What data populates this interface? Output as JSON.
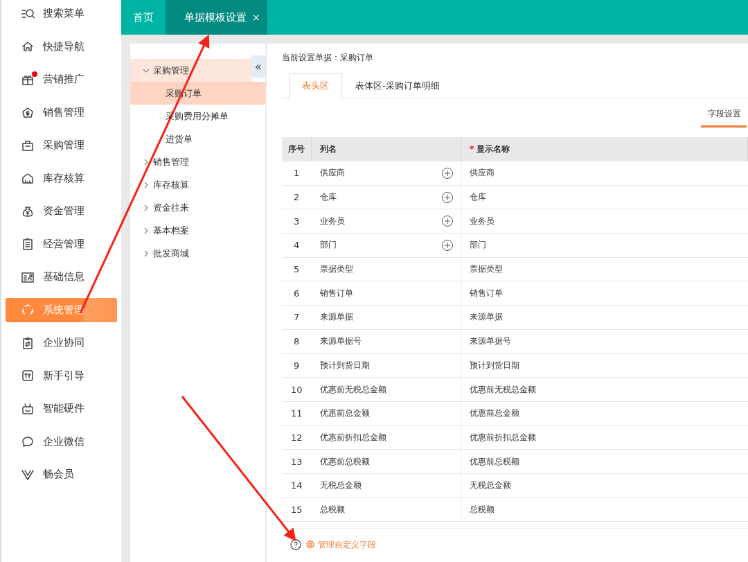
{
  "sidebar": {
    "items": [
      {
        "label": "搜索菜单",
        "selected": false,
        "notification": false
      },
      {
        "label": "快捷导航",
        "selected": false,
        "notification": false
      },
      {
        "label": "营销推广",
        "selected": false,
        "notification": true
      },
      {
        "label": "销售管理",
        "selected": false,
        "notification": false
      },
      {
        "label": "采购管理",
        "selected": false,
        "notification": false
      },
      {
        "label": "库存核算",
        "selected": false,
        "notification": false
      },
      {
        "label": "资金管理",
        "selected": false,
        "notification": false
      },
      {
        "label": "经营管理",
        "selected": false,
        "notification": false
      },
      {
        "label": "基础信息",
        "selected": false,
        "notification": false
      },
      {
        "label": "系统管理",
        "selected": true,
        "notification": false
      },
      {
        "label": "企业协同",
        "selected": false,
        "notification": false
      },
      {
        "label": "新手引导",
        "selected": false,
        "notification": false
      },
      {
        "label": "智能硬件",
        "selected": false,
        "notification": false
      },
      {
        "label": "企业微信",
        "selected": false,
        "notification": false
      },
      {
        "label": "畅会员",
        "selected": false,
        "notification": false
      }
    ]
  },
  "tabs": [
    {
      "label": "首页",
      "selected": false
    },
    {
      "label": "单据模板设置",
      "selected": true,
      "close": "×"
    }
  ],
  "tree": {
    "collapse": "«",
    "items": [
      {
        "label": "采购管理",
        "expanded": true,
        "selected": false,
        "children": [
          {
            "label": "采购订单",
            "selected": true
          },
          {
            "label": "采购费用分摊单",
            "selected": false
          },
          {
            "label": "进货单",
            "selected": false
          }
        ]
      },
      {
        "label": "销售管理",
        "expanded": false,
        "selected": false
      },
      {
        "label": "库存核算",
        "expanded": false,
        "selected": false
      },
      {
        "label": "资金往来",
        "expanded": false,
        "selected": false
      },
      {
        "label": "基本档案",
        "expanded": false,
        "selected": false
      },
      {
        "label": "批发商城",
        "expanded": false,
        "selected": false
      }
    ]
  },
  "current_document": "当前设置单据：采购订单",
  "document_tabs": [
    {
      "label": "表头区",
      "selected": true
    },
    {
      "label": "表体区-采购订单明细",
      "selected": false
    }
  ],
  "settings_tab": {
    "label": "字段设置",
    "selected": true
  },
  "table": {
    "columns": [
      {
        "label": "序号"
      },
      {
        "label": "列名"
      },
      {
        "label": "显示名称",
        "required_mark": "*"
      }
    ],
    "rows": [
      {
        "number": "1",
        "column_name": "供应商",
        "expandable": true,
        "display_name": "供应商"
      },
      {
        "number": "2",
        "column_name": "仓库",
        "expandable": true,
        "display_name": "仓库"
      },
      {
        "number": "3",
        "column_name": "业务员",
        "expandable": true,
        "display_name": "业务员"
      },
      {
        "number": "4",
        "column_name": "部门",
        "expandable": true,
        "display_name": "部门"
      },
      {
        "number": "5",
        "column_name": "票据类型",
        "expandable": false,
        "display_name": "票据类型"
      },
      {
        "number": "6",
        "column_name": "销售订单",
        "expandable": false,
        "display_name": "销售订单"
      },
      {
        "number": "7",
        "column_name": "来源单据",
        "expandable": false,
        "display_name": "来源单据"
      },
      {
        "number": "8",
        "column_name": "来源单据号",
        "expandable": false,
        "display_name": "来源单据号"
      },
      {
        "number": "9",
        "column_name": "预计到货日期",
        "expandable": false,
        "display_name": "预计到货日期"
      },
      {
        "number": "10",
        "column_name": "优惠前无税总金额",
        "expandable": false,
        "display_name": "优惠前无税总金额"
      },
      {
        "number": "11",
        "column_name": "优惠前总金额",
        "expandable": false,
        "display_name": "优惠前总金额"
      },
      {
        "number": "12",
        "column_name": "优惠前折扣总金额",
        "expandable": false,
        "display_name": "优惠前折扣总金额"
      },
      {
        "number": "13",
        "column_name": "优惠前总税额",
        "expandable": false,
        "display_name": "优惠前总税额"
      },
      {
        "number": "14",
        "column_name": "无税总金额",
        "expandable": false,
        "display_name": "无税总金额"
      },
      {
        "number": "15",
        "column_name": "总税额",
        "expandable": false,
        "display_name": "总税额"
      }
    ]
  },
  "footer": {
    "link": "管理自定义字段"
  }
}
